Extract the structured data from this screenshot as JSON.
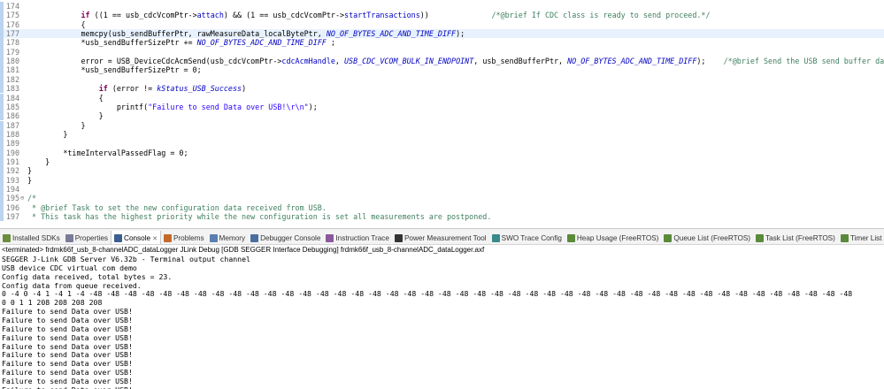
{
  "editor": {
    "lines": [
      {
        "num": "174",
        "fold": "",
        "html": ""
      },
      {
        "num": "175",
        "fold": "",
        "html": "            <span class='kw'>if</span> ((1 == usb_cdcVcomPtr-><span class='field'>attach</span>) && (1 == usb_cdcVcomPtr-><span class='field'>startTransactions</span>))              <span class='com'>/*@brief If CDC class is ready to send proceed.*/</span>"
      },
      {
        "num": "176",
        "fold": "",
        "html": "            {"
      },
      {
        "num": "177",
        "fold": "",
        "html": "            <span class='fn'>memcpy</span>(usb_sendBufferPtr, rawMeasureData_localBytePtr, <span class='macro'>NO_OF_BYTES_ADC_AND_TIME_DIFF</span>);",
        "current": true
      },
      {
        "num": "178",
        "fold": "",
        "html": "            *usb_sendBufferSizePtr += <span class='macro'>NO_OF_BYTES_ADC_AND_TIME_DIFF</span> ;"
      },
      {
        "num": "179",
        "fold": "",
        "html": ""
      },
      {
        "num": "180",
        "fold": "",
        "html": "            error = USB_DeviceCdcAcmSend(usb_cdcVcomPtr-><span class='field'>cdcAcmHandle</span>, <span class='macro'>USB_CDC_VCOM_BULK_IN_ENDPOINT</span>, usb_sendBufferPtr, <span class='macro'>NO_OF_BYTES_ADC_AND_TIME_DIFF</span>);    <span class='com'>/*@brief Send the USB send buffer data over USB.*/</span>"
      },
      {
        "num": "181",
        "fold": "",
        "html": "            *usb_sendBufferSizePtr = 0;"
      },
      {
        "num": "182",
        "fold": "",
        "html": ""
      },
      {
        "num": "183",
        "fold": "",
        "html": "                <span class='kw'>if</span> (error != <span class='macro'>kStatus_USB_Success</span>)"
      },
      {
        "num": "184",
        "fold": "",
        "html": "                {"
      },
      {
        "num": "185",
        "fold": "",
        "html": "                    printf(<span class='str'>\"Failure to send Data over USB!\\r\\n\"</span>);"
      },
      {
        "num": "186",
        "fold": "",
        "html": "                }"
      },
      {
        "num": "187",
        "fold": "",
        "html": "            }"
      },
      {
        "num": "188",
        "fold": "",
        "html": "        }"
      },
      {
        "num": "189",
        "fold": "",
        "html": ""
      },
      {
        "num": "190",
        "fold": "",
        "html": "        *timeIntervalPassedFlag = 0;"
      },
      {
        "num": "191",
        "fold": "",
        "html": "    }"
      },
      {
        "num": "192",
        "fold": "",
        "html": "}"
      },
      {
        "num": "193",
        "fold": "",
        "html": "}"
      },
      {
        "num": "194",
        "fold": "",
        "html": ""
      },
      {
        "num": "195",
        "fold": "⊖",
        "html": "<span class='com'>/*</span>"
      },
      {
        "num": "196",
        "fold": "",
        "html": " <span class='com'>* @brief Task to set the new configuration data received from USB.</span>"
      },
      {
        "num": "197",
        "fold": "",
        "html": " <span class='com'>* This task has the highest priority while the new configuration is set all measurements are postponed.</span>"
      }
    ]
  },
  "tabs": [
    {
      "label": "Installed SDKs",
      "icon": "sdk-icon",
      "color": "#6b8e3d",
      "active": false
    },
    {
      "label": "Properties",
      "icon": "properties-icon",
      "color": "#7a7a9a",
      "active": false
    },
    {
      "label": "Console",
      "icon": "console-icon",
      "color": "#3a5f8f",
      "active": true
    },
    {
      "label": "Problems",
      "icon": "problems-icon",
      "color": "#c46a2a",
      "active": false
    },
    {
      "label": "Memory",
      "icon": "memory-icon",
      "color": "#5a7fb0",
      "active": false
    },
    {
      "label": "Debugger Console",
      "icon": "debugger-console-icon",
      "color": "#4a6fa0",
      "active": false
    },
    {
      "label": "Instruction Trace",
      "icon": "instruction-trace-icon",
      "color": "#8a5a9a",
      "active": false
    },
    {
      "label": "Power Measurement Tool",
      "icon": "power-icon",
      "color": "#333333",
      "active": false
    },
    {
      "label": "SWO Trace Config",
      "icon": "swo-trace-icon",
      "color": "#3a8a8a",
      "active": false
    },
    {
      "label": "Heap Usage (FreeRTOS)",
      "icon": "heap-usage-icon",
      "color": "#5a8a3a",
      "active": false
    },
    {
      "label": "Queue List (FreeRTOS)",
      "icon": "queue-list-icon",
      "color": "#5a8a3a",
      "active": false
    },
    {
      "label": "Task List (FreeRTOS)",
      "icon": "task-list-icon",
      "color": "#5a8a3a",
      "active": false
    },
    {
      "label": "Timer List (FreeRTOS)",
      "icon": "timer-list-icon",
      "color": "#5a8a3a",
      "active": false
    }
  ],
  "console": {
    "header": "<terminated> frdmk66f_usb_8-channelADC_dataLogger JLink Debug [GDB SEGGER Interface Debugging] frdmk66f_usb_8-channelADC_dataLogger.axf",
    "lines": [
      "SEGGER J-Link GDB Server V6.32b - Terminal output channel",
      "USB device CDC virtual com demo",
      "Config data received, total bytes = 23.",
      "Config data from queue received.",
      "0 -4 0 -4 1 -4 1 -4 -48 -48 -48 -48 -48 -48 -48 -48 -48 -48 -48 -48 -48 -48 -48 -48 -48 -48 -48 -48 -48 -48 -48 -48 -48 -48 -48 -48 -48 -48 -48 -48 -48 -48 -48 -48 -48 -48 -48 -48 -48 -48 -48 -48",
      "0 0 1 1 208 208 208 208",
      "Failure to send Data over USB!",
      "Failure to send Data over USB!",
      "Failure to send Data over USB!",
      "Failure to send Data over USB!",
      "Failure to send Data over USB!",
      "Failure to send Data over USB!",
      "Failure to send Data over USB!",
      "Failure to send Data over USB!",
      "Failure to send Data over USB!",
      "Failure to send Data over USB!"
    ]
  }
}
